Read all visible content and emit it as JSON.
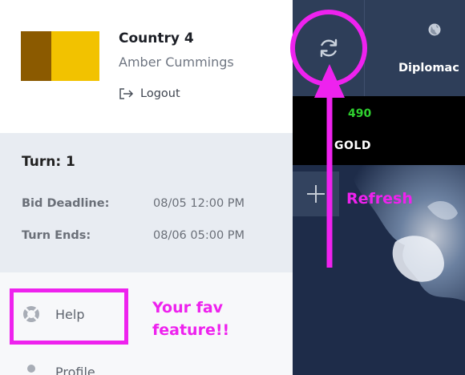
{
  "player": {
    "country": "Country 4",
    "name": "Amber Cummings",
    "logout_label": "Logout",
    "flag_colors": [
      "#8b5a00",
      "#f2c200"
    ]
  },
  "turn": {
    "title": "Turn: 1",
    "bid_deadline_label": "Bid Deadline:",
    "bid_deadline_value": "08/05 12:00 PM",
    "turn_ends_label": "Turn Ends:",
    "turn_ends_value": "08/06 05:00 PM"
  },
  "menu": {
    "items": [
      {
        "label": "Help",
        "icon": "lifebuoy-icon"
      },
      {
        "label": "Profile",
        "icon": "user-icon"
      }
    ]
  },
  "game": {
    "refresh_icon": "refresh-icon",
    "diplomacy_label": "Diplomac",
    "diplomacy_icon": "globe-icon",
    "gold_value": "490",
    "gold_label": "GOLD",
    "add_icon": "plus-icon"
  },
  "annotations": {
    "refresh_text": "Refresh",
    "fav_text_line1": "Your fav",
    "fav_text_line2": "feature!!",
    "color": "#ee22ee"
  }
}
